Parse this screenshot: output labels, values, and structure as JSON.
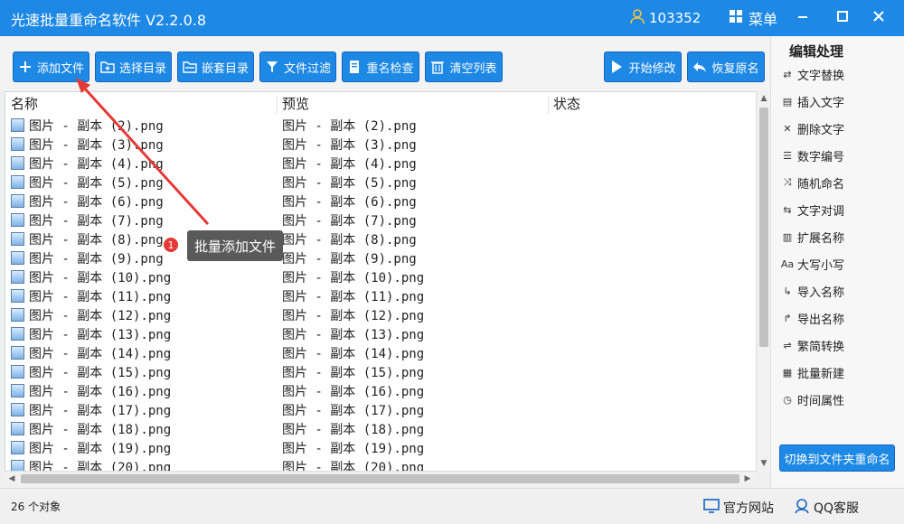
{
  "titlebar": {
    "title": "光速批量重命名软件 V2.2.0.8",
    "user_id": "103352",
    "menu_label": "菜单"
  },
  "toolbar": {
    "add_files": "添加文件",
    "select_dir": "选择目录",
    "nested_dir": "嵌套目录",
    "file_filter": "文件过滤",
    "rename_check": "重名检查",
    "clear_list": "清空列表",
    "start_modify": "开始修改",
    "restore_name": "恢复原名"
  },
  "list": {
    "columns": [
      "名称",
      "预览",
      "状态"
    ],
    "rows": [
      {
        "name": "图片 - 副本 (2).png",
        "preview": "图片 - 副本 (2).png"
      },
      {
        "name": "图片 - 副本 (3).png",
        "preview": "图片 - 副本 (3).png"
      },
      {
        "name": "图片 - 副本 (4).png",
        "preview": "图片 - 副本 (4).png"
      },
      {
        "name": "图片 - 副本 (5).png",
        "preview": "图片 - 副本 (5).png"
      },
      {
        "name": "图片 - 副本 (6).png",
        "preview": "图片 - 副本 (6).png"
      },
      {
        "name": "图片 - 副本 (7).png",
        "preview": "图片 - 副本 (7).png"
      },
      {
        "name": "图片 - 副本 (8).png",
        "preview": "图片 - 副本 (8).png"
      },
      {
        "name": "图片 - 副本 (9).png",
        "preview": "图片 - 副本 (9).png"
      },
      {
        "name": "图片 - 副本 (10).png",
        "preview": "图片 - 副本 (10).png"
      },
      {
        "name": "图片 - 副本 (11).png",
        "preview": "图片 - 副本 (11).png"
      },
      {
        "name": "图片 - 副本 (12).png",
        "preview": "图片 - 副本 (12).png"
      },
      {
        "name": "图片 - 副本 (13).png",
        "preview": "图片 - 副本 (13).png"
      },
      {
        "name": "图片 - 副本 (14).png",
        "preview": "图片 - 副本 (14).png"
      },
      {
        "name": "图片 - 副本 (15).png",
        "preview": "图片 - 副本 (15).png"
      },
      {
        "name": "图片 - 副本 (16).png",
        "preview": "图片 - 副本 (16).png"
      },
      {
        "name": "图片 - 副本 (17).png",
        "preview": "图片 - 副本 (17).png"
      },
      {
        "name": "图片 - 副本 (18).png",
        "preview": "图片 - 副本 (18).png"
      },
      {
        "name": "图片 - 副本 (19).png",
        "preview": "图片 - 副本 (19).png"
      },
      {
        "name": "图片 - 副本 (20).png",
        "preview": "图片 - 副本 (20).png"
      }
    ]
  },
  "sidebar": {
    "title": "编辑处理",
    "items": [
      {
        "label": "文字替换",
        "icon": "swap-icon"
      },
      {
        "label": "插入文字",
        "icon": "insert-doc-icon"
      },
      {
        "label": "删除文字",
        "icon": "delete-doc-icon"
      },
      {
        "label": "数字编号",
        "icon": "list-number-icon"
      },
      {
        "label": "随机命名",
        "icon": "shuffle-icon"
      },
      {
        "label": "文字对调",
        "icon": "exchange-icon"
      },
      {
        "label": "扩展名称",
        "icon": "extension-icon"
      },
      {
        "label": "大写小写",
        "icon": "case-icon"
      },
      {
        "label": "导入名称",
        "icon": "import-icon"
      },
      {
        "label": "导出名称",
        "icon": "export-icon"
      },
      {
        "label": "繁简转换",
        "icon": "convert-icon"
      },
      {
        "label": "批量新建",
        "icon": "new-doc-icon"
      },
      {
        "label": "时间属性",
        "icon": "clock-icon"
      }
    ],
    "switch_button": "切换到文件夹重命名"
  },
  "status": {
    "count": "26 个对象",
    "website": "官方网站",
    "qq_service": "QQ客服"
  },
  "annotation": {
    "badge": "1",
    "callout": "批量添加文件"
  },
  "colors": {
    "accent": "#1e88e5",
    "annotation_arrow": "#e53935"
  }
}
